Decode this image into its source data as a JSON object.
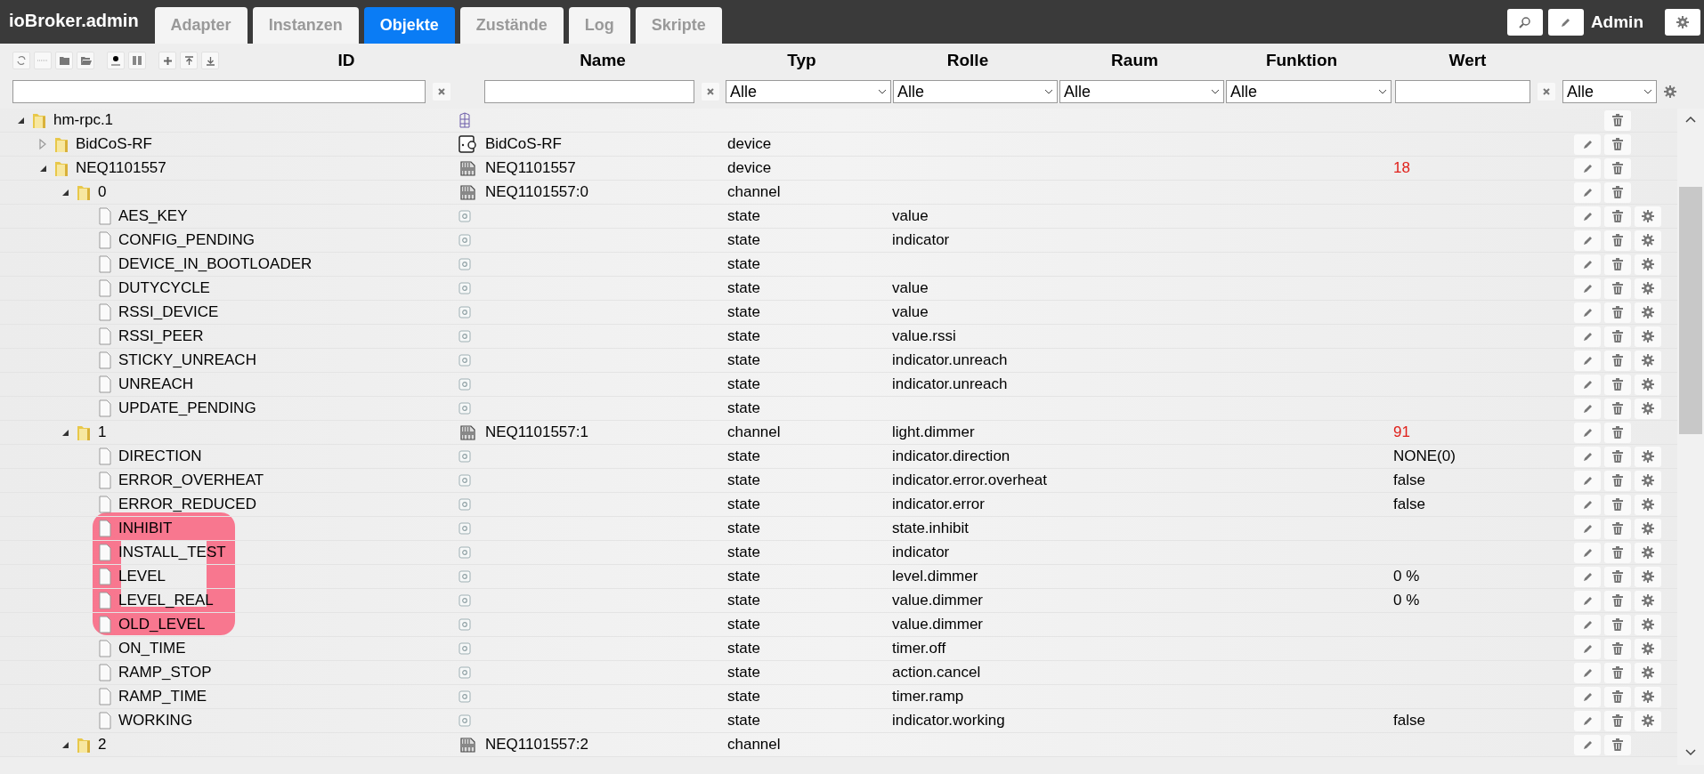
{
  "app": {
    "title": "ioBroker.admin"
  },
  "tabs": [
    {
      "label": "Adapter",
      "selected": false
    },
    {
      "label": "Instanzen",
      "selected": false
    },
    {
      "label": "Objekte",
      "selected": true
    },
    {
      "label": "Zustände",
      "selected": false
    },
    {
      "label": "Log",
      "selected": false
    },
    {
      "label": "Skripte",
      "selected": false
    }
  ],
  "user": {
    "name": "Admin"
  },
  "columns": [
    {
      "label": "ID"
    },
    {
      "label": "Name"
    },
    {
      "label": "Typ"
    },
    {
      "label": "Rolle"
    },
    {
      "label": "Raum"
    },
    {
      "label": "Funktion"
    },
    {
      "label": "Wert"
    }
  ],
  "filters": {
    "typ": "Alle",
    "rolle": "Alle",
    "raum": "Alle",
    "funktion": "Alle",
    "ack": "Alle"
  },
  "tree": [
    {
      "id": "hm-rpc.1",
      "kind": "adapter",
      "expanded": true,
      "editable": false,
      "configurable": false,
      "children": [
        {
          "id": "BidCoS-RF",
          "kind": "interface",
          "expanded": false,
          "name": "BidCoS-RF",
          "type": "device",
          "editable": true,
          "configurable": false
        },
        {
          "id": "NEQ1101557",
          "kind": "device",
          "expanded": true,
          "name": "NEQ1101557",
          "type": "device",
          "value": "18",
          "ack": false,
          "editable": true,
          "configurable": false,
          "children": [
            {
              "id": "0",
              "kind": "channel",
              "expanded": true,
              "name": "NEQ1101557:0",
              "type": "channel",
              "editable": true,
              "configurable": false,
              "children": [
                {
                  "id": "AES_KEY",
                  "kind": "state",
                  "type": "state",
                  "role": "value",
                  "editable": true,
                  "configurable": true
                },
                {
                  "id": "CONFIG_PENDING",
                  "kind": "state",
                  "type": "state",
                  "role": "indicator",
                  "editable": true,
                  "configurable": true
                },
                {
                  "id": "DEVICE_IN_BOOTLOADER",
                  "kind": "state",
                  "type": "state",
                  "editable": true,
                  "configurable": true
                },
                {
                  "id": "DUTYCYCLE",
                  "kind": "state",
                  "type": "state",
                  "role": "value",
                  "editable": true,
                  "configurable": true
                },
                {
                  "id": "RSSI_DEVICE",
                  "kind": "state",
                  "type": "state",
                  "role": "value",
                  "editable": true,
                  "configurable": true
                },
                {
                  "id": "RSSI_PEER",
                  "kind": "state",
                  "type": "state",
                  "role": "value.rssi",
                  "editable": true,
                  "configurable": true
                },
                {
                  "id": "STICKY_UNREACH",
                  "kind": "state",
                  "type": "state",
                  "role": "indicator.unreach",
                  "editable": true,
                  "configurable": true
                },
                {
                  "id": "UNREACH",
                  "kind": "state",
                  "type": "state",
                  "role": "indicator.unreach",
                  "editable": true,
                  "configurable": true
                },
                {
                  "id": "UPDATE_PENDING",
                  "kind": "state",
                  "type": "state",
                  "editable": true,
                  "configurable": true
                }
              ]
            },
            {
              "id": "1",
              "kind": "channel",
              "expanded": true,
              "name": "NEQ1101557:1",
              "type": "channel",
              "role": "light.dimmer",
              "value": "91",
              "ack": false,
              "editable": true,
              "configurable": false,
              "children": [
                {
                  "id": "DIRECTION",
                  "kind": "state",
                  "type": "state",
                  "role": "indicator.direction",
                  "value": "NONE(0)",
                  "ack": true,
                  "editable": true,
                  "configurable": true
                },
                {
                  "id": "ERROR_OVERHEAT",
                  "kind": "state",
                  "type": "state",
                  "role": "indicator.error.overheat",
                  "value": "false",
                  "ack": true,
                  "editable": true,
                  "configurable": true
                },
                {
                  "id": "ERROR_REDUCED",
                  "kind": "state",
                  "type": "state",
                  "role": "indicator.error",
                  "value": "false",
                  "ack": true,
                  "editable": true,
                  "configurable": true
                },
                {
                  "id": "INHIBIT",
                  "kind": "state",
                  "type": "state",
                  "role": "state.inhibit",
                  "editable": true,
                  "configurable": true
                },
                {
                  "id": "INSTALL_TEST",
                  "kind": "state",
                  "type": "state",
                  "role": "indicator",
                  "editable": true,
                  "configurable": true
                },
                {
                  "id": "LEVEL",
                  "kind": "state",
                  "type": "state",
                  "role": "level.dimmer",
                  "value": "0 %",
                  "ack": true,
                  "editable": true,
                  "configurable": true
                },
                {
                  "id": "LEVEL_REAL",
                  "kind": "state",
                  "type": "state",
                  "role": "value.dimmer",
                  "value": "0 %",
                  "ack": true,
                  "editable": true,
                  "configurable": true
                },
                {
                  "id": "OLD_LEVEL",
                  "kind": "state",
                  "type": "state",
                  "role": "value.dimmer",
                  "editable": true,
                  "configurable": true
                },
                {
                  "id": "ON_TIME",
                  "kind": "state",
                  "type": "state",
                  "role": "timer.off",
                  "editable": true,
                  "configurable": true
                },
                {
                  "id": "RAMP_STOP",
                  "kind": "state",
                  "type": "state",
                  "role": "action.cancel",
                  "editable": true,
                  "configurable": true
                },
                {
                  "id": "RAMP_TIME",
                  "kind": "state",
                  "type": "state",
                  "role": "timer.ramp",
                  "editable": true,
                  "configurable": true
                },
                {
                  "id": "WORKING",
                  "kind": "state",
                  "type": "state",
                  "role": "indicator.working",
                  "value": "false",
                  "ack": true,
                  "editable": true,
                  "configurable": true
                }
              ]
            },
            {
              "id": "2",
              "kind": "channel",
              "expanded": true,
              "name": "NEQ1101557:2",
              "type": "channel",
              "editable": true,
              "configurable": false
            }
          ]
        }
      ]
    }
  ]
}
